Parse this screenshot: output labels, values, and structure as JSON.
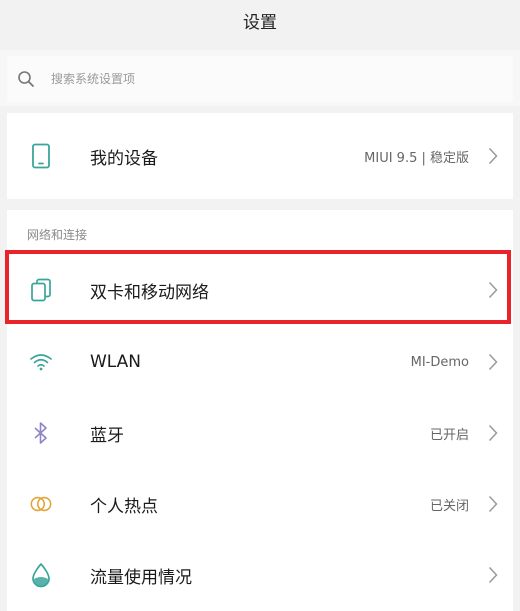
{
  "header": {
    "title": "设置"
  },
  "search": {
    "placeholder": "搜索系统设置项",
    "icon": "search-icon"
  },
  "device": {
    "label": "我的设备",
    "value": "MIUI 9.5 | 稳定版",
    "icon": "phone-icon"
  },
  "network_section": {
    "header": "网络和连接",
    "items": [
      {
        "label": "双卡和移动网络",
        "value": "",
        "icon": "sim-card-icon"
      },
      {
        "label": "WLAN",
        "value": "MI-Demo",
        "icon": "wifi-icon"
      },
      {
        "label": "蓝牙",
        "value": "已开启",
        "icon": "bluetooth-icon"
      },
      {
        "label": "个人热点",
        "value": "已关闭",
        "icon": "hotspot-icon"
      },
      {
        "label": "流量使用情况",
        "value": "",
        "icon": "data-usage-icon"
      }
    ]
  },
  "colors": {
    "accent": "#3aa59a",
    "highlight": "#e8232a",
    "bluetooth": "#8f86c8"
  }
}
